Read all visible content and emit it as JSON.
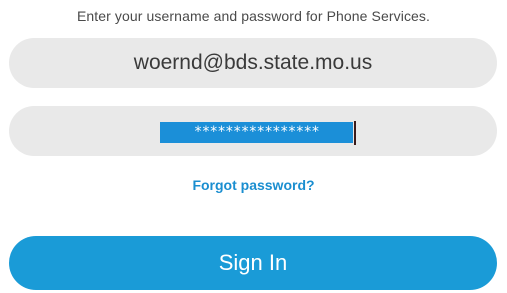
{
  "login": {
    "instruction": "Enter your username and password for Phone Services.",
    "username_value": "woernd@bds.state.mo.us",
    "password_value": "****************",
    "forgot_label": "Forgot password?",
    "signin_label": "Sign In"
  },
  "colors": {
    "field_background": "#e9e9e9",
    "selection": "#1b8fd8",
    "link": "#1a8ed0",
    "button": "#1a9bd7"
  }
}
